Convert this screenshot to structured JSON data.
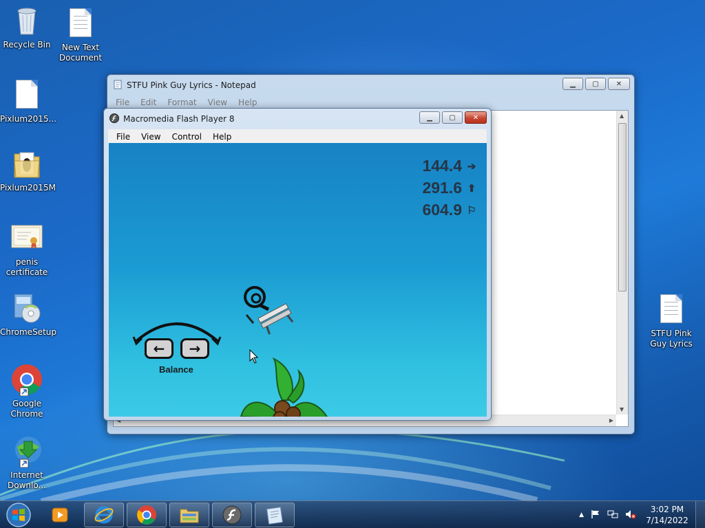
{
  "desktop": {
    "icons": [
      {
        "label": "Recycle Bin"
      },
      {
        "label": "New Text Document"
      },
      {
        "label": "Pixlum2015..."
      },
      {
        "label": "Pixlum2015M"
      },
      {
        "label": "penis certificate"
      },
      {
        "label": "ChromeSetup"
      },
      {
        "label": "Google Chrome"
      },
      {
        "label": "Internet Downlo..."
      },
      {
        "label": "STFU Pink Guy Lyrics"
      }
    ]
  },
  "notepad": {
    "title": "STFU Pink Guy Lyrics - Notepad",
    "menu": [
      "File",
      "Edit",
      "Format",
      "View",
      "Help"
    ]
  },
  "flash": {
    "title": "Macromedia Flash Player 8",
    "menu": [
      "File",
      "View",
      "Control",
      "Help"
    ],
    "game": {
      "stats": [
        {
          "value": "144.4",
          "icon": "arrow-right-icon"
        },
        {
          "value": "291.6",
          "icon": "arrow-up-icon"
        },
        {
          "value": "604.9",
          "icon": "flag-icon"
        }
      ],
      "balance_label": "Balance",
      "left_key": "←",
      "right_key": "→"
    }
  },
  "taskbar": {
    "apps": [
      "windows-media-player",
      "internet-explorer",
      "google-chrome",
      "windows-explorer",
      "flash-player",
      "notepad"
    ],
    "clock_time": "3:02 PM",
    "clock_date": "7/14/2022"
  },
  "colors": {
    "sky_top": "#1782c4",
    "sky_bottom": "#3ccbe6",
    "close_button": "#c74733"
  }
}
